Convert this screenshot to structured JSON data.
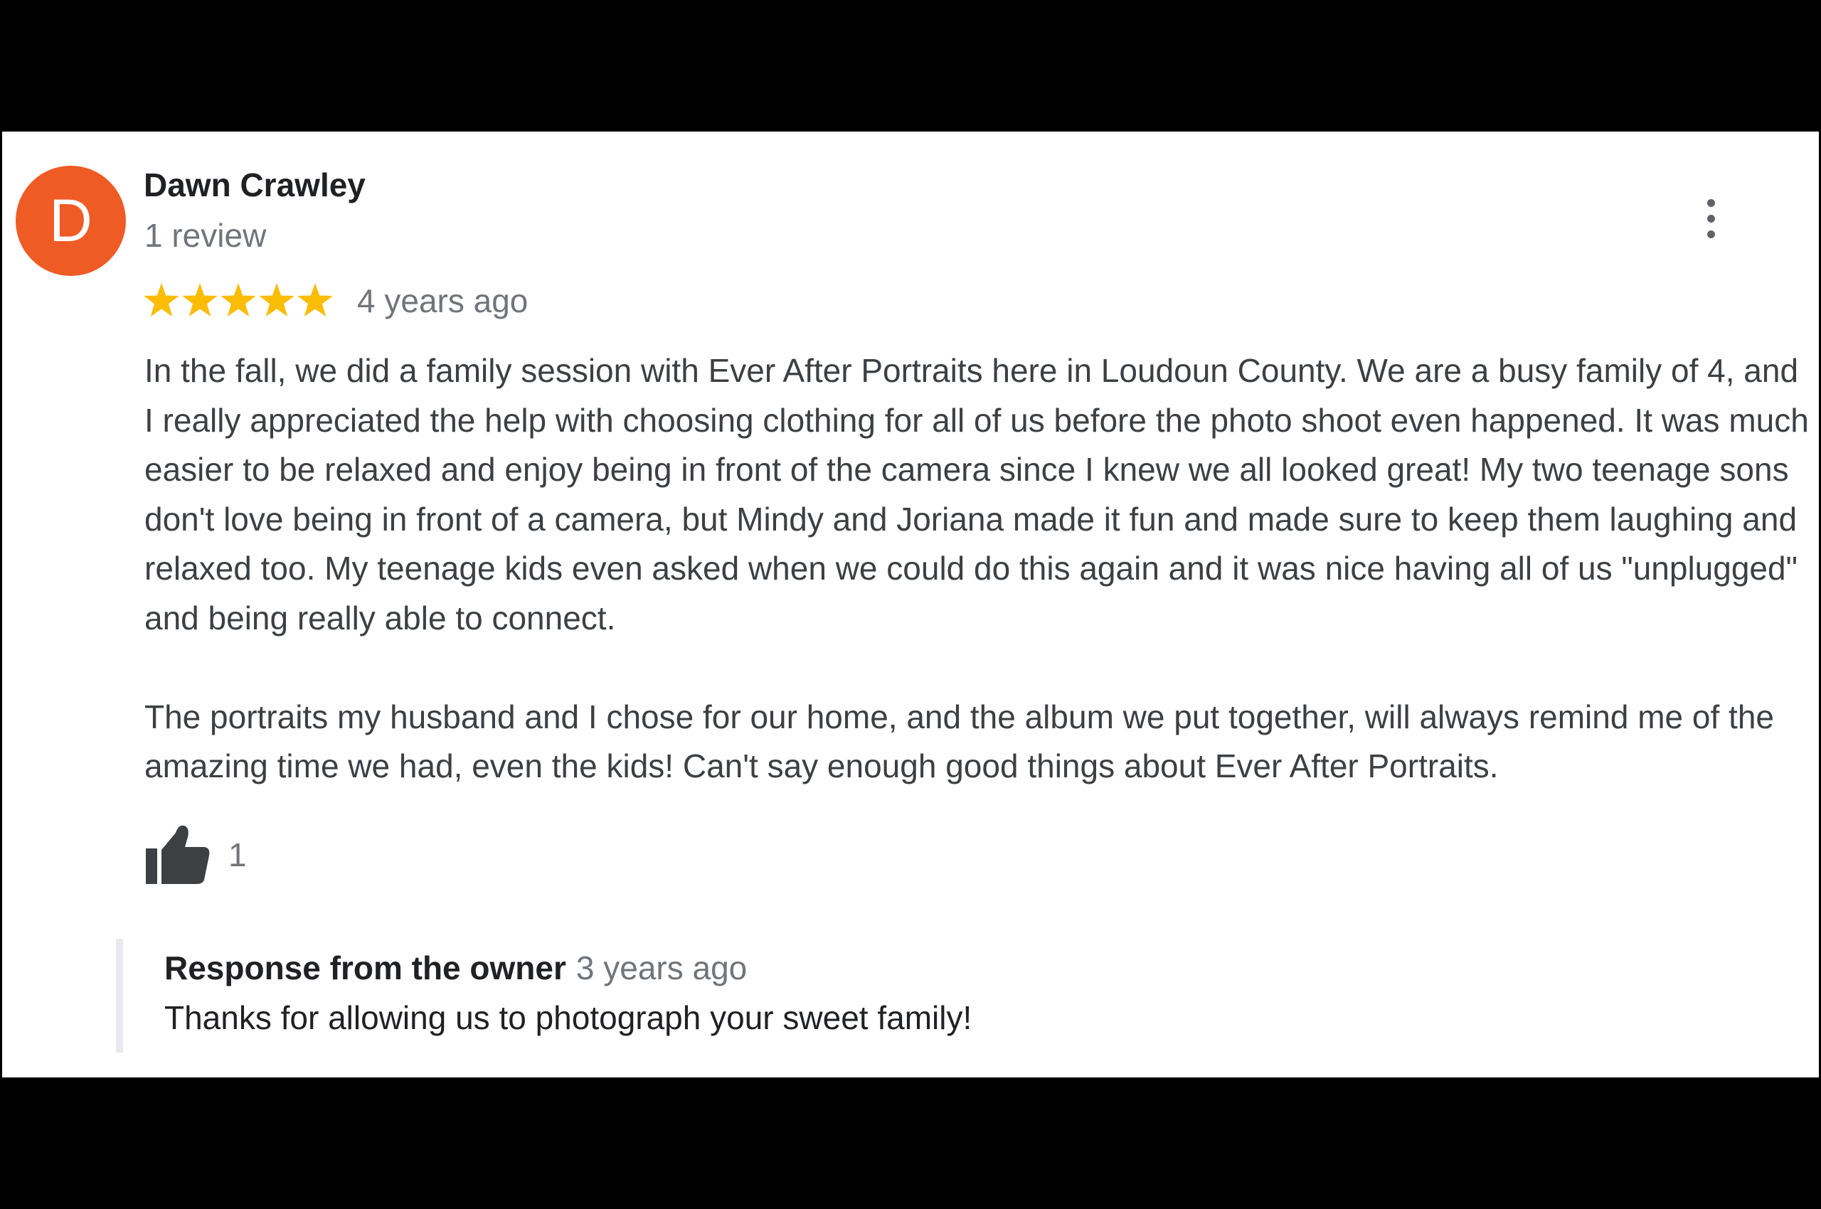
{
  "review": {
    "avatar_letter": "D",
    "avatar_color": "#ef5b25",
    "reviewer_name": "Dawn Crawley",
    "review_count": "1 review",
    "rating": 5,
    "rating_max": 5,
    "star_color": "#fbbc04",
    "date": "4 years ago",
    "paragraphs": [
      "In the fall, we did a family session with Ever After Portraits here in Loudoun County.  We are a busy family of 4, and I really appreciated the help with choosing clothing for all of us before the photo shoot even happened.  It was much easier to be relaxed and enjoy being in front of the camera since I knew we all looked great!  My two teenage sons don't love being in front of a camera, but Mindy and Joriana made it fun and made sure to keep them laughing and relaxed too. My teenage kids even asked when we could do this again and it was nice having all of us \"unplugged\" and being really able to connect.",
      "The portraits my husband and I chose for our home, and the album we put together, will always remind me of the amazing time we had, even the kids! Can't say enough good things about Ever After Portraits."
    ],
    "like_count": "1",
    "more_icon": "more-vertical-icon",
    "like_icon": "thumbs-up-icon"
  },
  "owner_response": {
    "title": "Response from the owner",
    "date": "3 years ago",
    "text": "Thanks for allowing us to photograph your sweet family!"
  }
}
